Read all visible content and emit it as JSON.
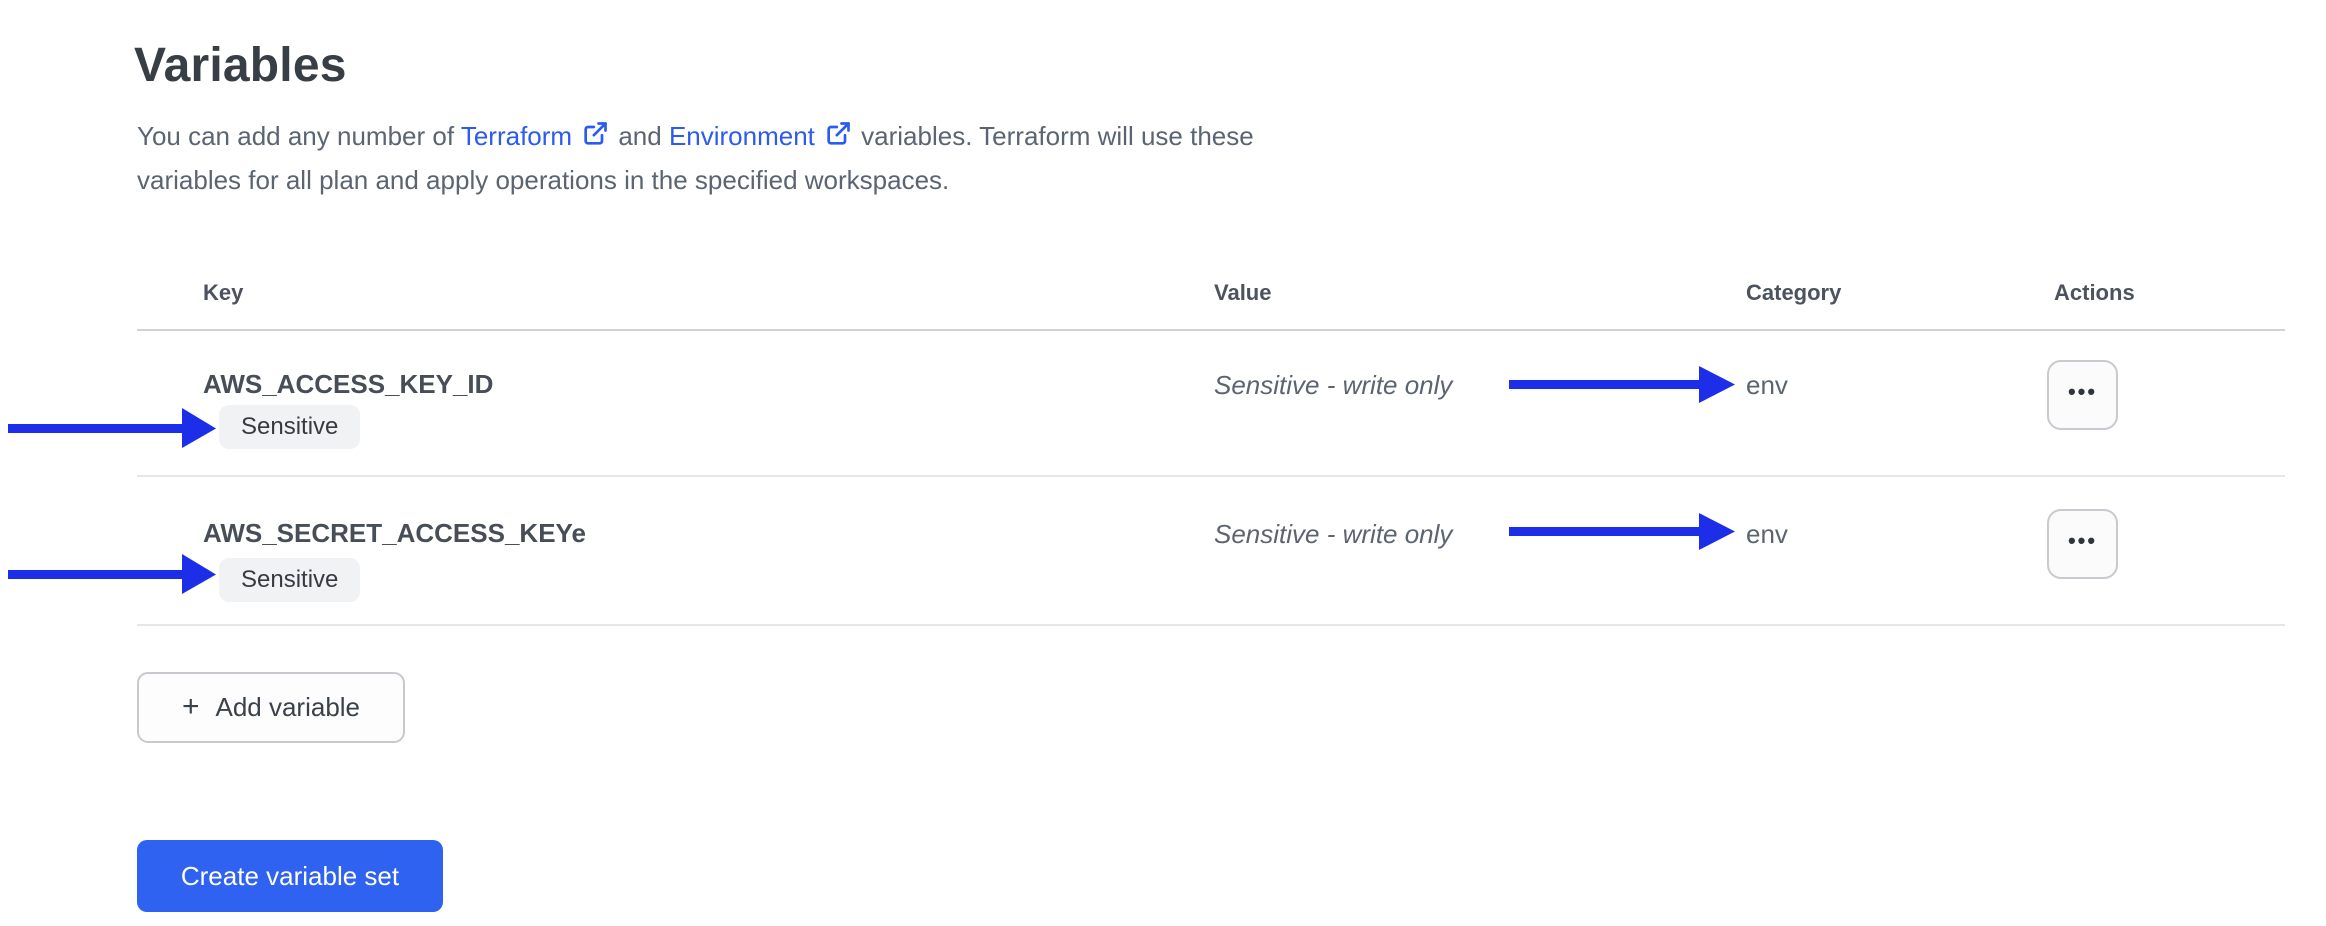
{
  "page": {
    "title": "Variables",
    "description": {
      "text_before": "You can add any number of",
      "link_terraform": "Terraform",
      "text_middle": "and",
      "link_environment": "Environment",
      "text_after": "variables. Terraform will use these variables for all plan and apply operations in the specified workspaces."
    }
  },
  "table": {
    "headers": {
      "key": "Key",
      "value": "Value",
      "category": "Category",
      "actions": "Actions"
    },
    "rows": [
      {
        "key": "AWS_ACCESS_KEY_ID",
        "badge": "Sensitive",
        "value": "Sensitive - write only",
        "category": "env"
      },
      {
        "key": "AWS_SECRET_ACCESS_KEYe",
        "badge": "Sensitive",
        "value": "Sensitive - write only",
        "category": "env"
      }
    ]
  },
  "buttons": {
    "add_variable": "Add variable",
    "create_variable_set": "Create variable set"
  },
  "icons": {
    "plus_glyph": "+",
    "ellipsis_glyph": "•••",
    "external_link_name": "external-link-icon"
  },
  "colors": {
    "link_blue": "#2b5bf0",
    "primary_button_blue": "#2f62f0",
    "annotation_arrow_blue": "#1c2ee8",
    "badge_background": "#f1f2f4"
  }
}
